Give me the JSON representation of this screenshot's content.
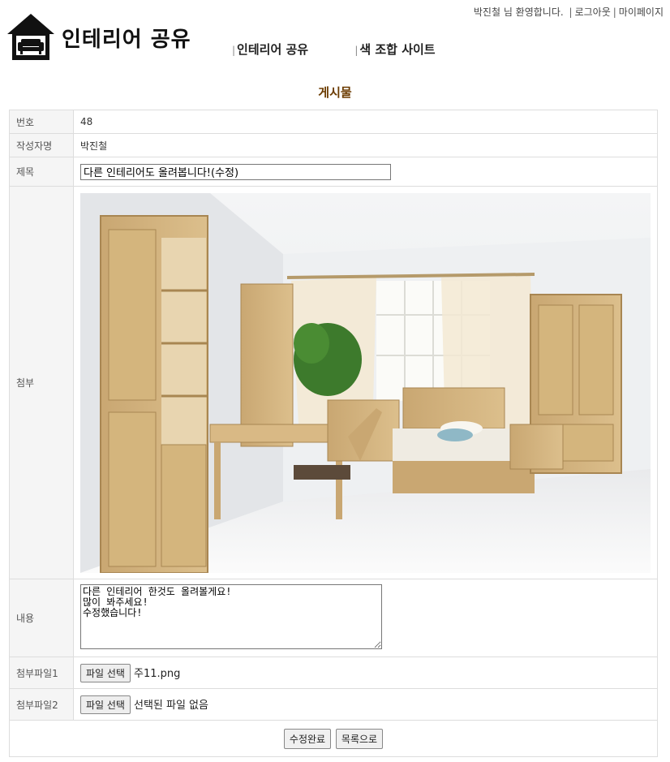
{
  "header": {
    "welcome": "박진철 님 환영합니다.",
    "logout": "로그아웃",
    "mypage": "마이페이지",
    "logo_text": "인테리어 공유"
  },
  "nav": {
    "item1": "인테리어 공유",
    "item2": "색 조합 사이트"
  },
  "board": {
    "title": "게시물",
    "rows": {
      "number_label": "번호",
      "number_value": "48",
      "author_label": "작성자명",
      "author_value": "박진철",
      "subject_label": "제목",
      "subject_value": "다른 인테리어도 올려봅니다!(수정)",
      "attach_label": "첨부",
      "content_label": "내용",
      "content_value": "다른 인테리어 한것도 올려볼게요!\n많이 봐주세요!\n수정했습니다!",
      "file1_label": "첨부파일1",
      "file1_button": "파일 선택",
      "file1_name": "주11.png",
      "file2_label": "첨부파일2",
      "file2_button": "파일 선택",
      "file2_name": "선택된 파일 없음"
    },
    "buttons": {
      "submit": "수정완료",
      "list": "목록으로"
    }
  },
  "colors": {
    "board_title": "#6b3b00",
    "label_bg": "#f5f5f5"
  }
}
